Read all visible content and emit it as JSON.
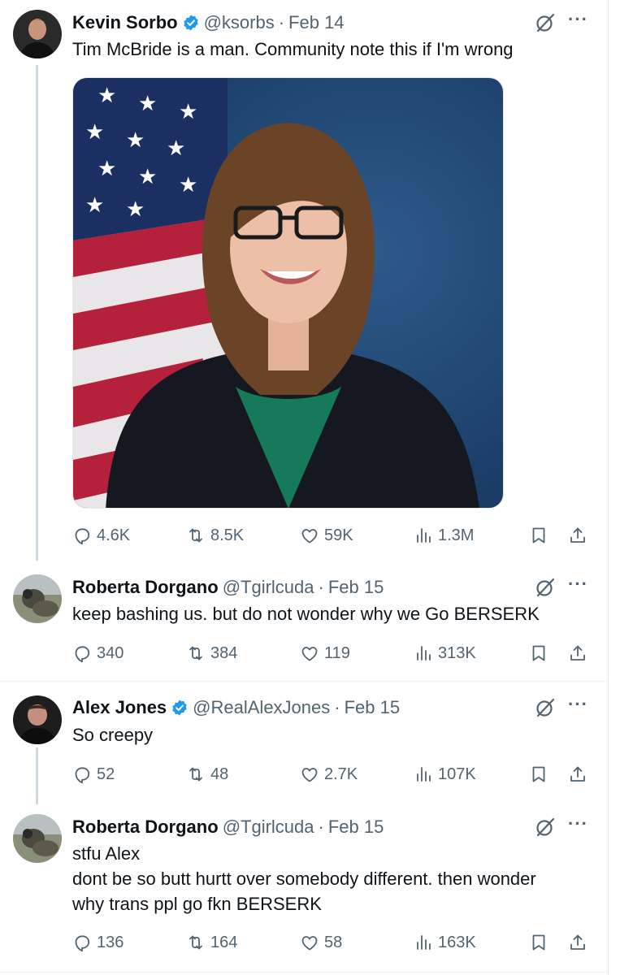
{
  "tweets": [
    {
      "name": "Kevin Sorbo",
      "handle": "@ksorbs",
      "date": "Feb 14",
      "text": [
        "Tim McBride is a man. Community note this if I'm wrong"
      ],
      "verified": true,
      "stats": {
        "replies": "4.6K",
        "retweets": "8.5K",
        "likes": "59K",
        "views": "1.3M"
      }
    },
    {
      "name": "Roberta Dorgano",
      "handle": "@Tgirlcuda",
      "date": "Feb 15",
      "text": [
        "keep bashing us. but do not wonder why we Go BERSERK"
      ],
      "verified": false,
      "stats": {
        "replies": "340",
        "retweets": "384",
        "likes": "119",
        "views": "313K"
      }
    },
    {
      "name": "Alex Jones",
      "handle": "@RealAlexJones",
      "date": "Feb 15",
      "text": [
        "So creepy"
      ],
      "verified": true,
      "stats": {
        "replies": "52",
        "retweets": "48",
        "likes": "2.7K",
        "views": "107K"
      }
    },
    {
      "name": "Roberta Dorgano",
      "handle": "@Tgirlcuda",
      "date": "Feb 15",
      "text": [
        "stfu Alex",
        "dont be so butt hurtt over somebody different. then wonder",
        "why trans ppl go fkn BERSERK"
      ],
      "verified": false,
      "stats": {
        "replies": "136",
        "retweets": "164",
        "likes": "58",
        "views": "163K"
      }
    }
  ],
  "separator_dot": "·",
  "more_label": "···",
  "colors": {
    "secondary_text": "#536471",
    "verified_blue": "#1d9bf0",
    "thread_line": "#cfd9de"
  },
  "icons": [
    "grok-icon",
    "more-icon",
    "verified-badge-icon",
    "reply-icon",
    "retweet-icon",
    "like-icon",
    "views-icon",
    "bookmark-icon",
    "share-icon"
  ]
}
